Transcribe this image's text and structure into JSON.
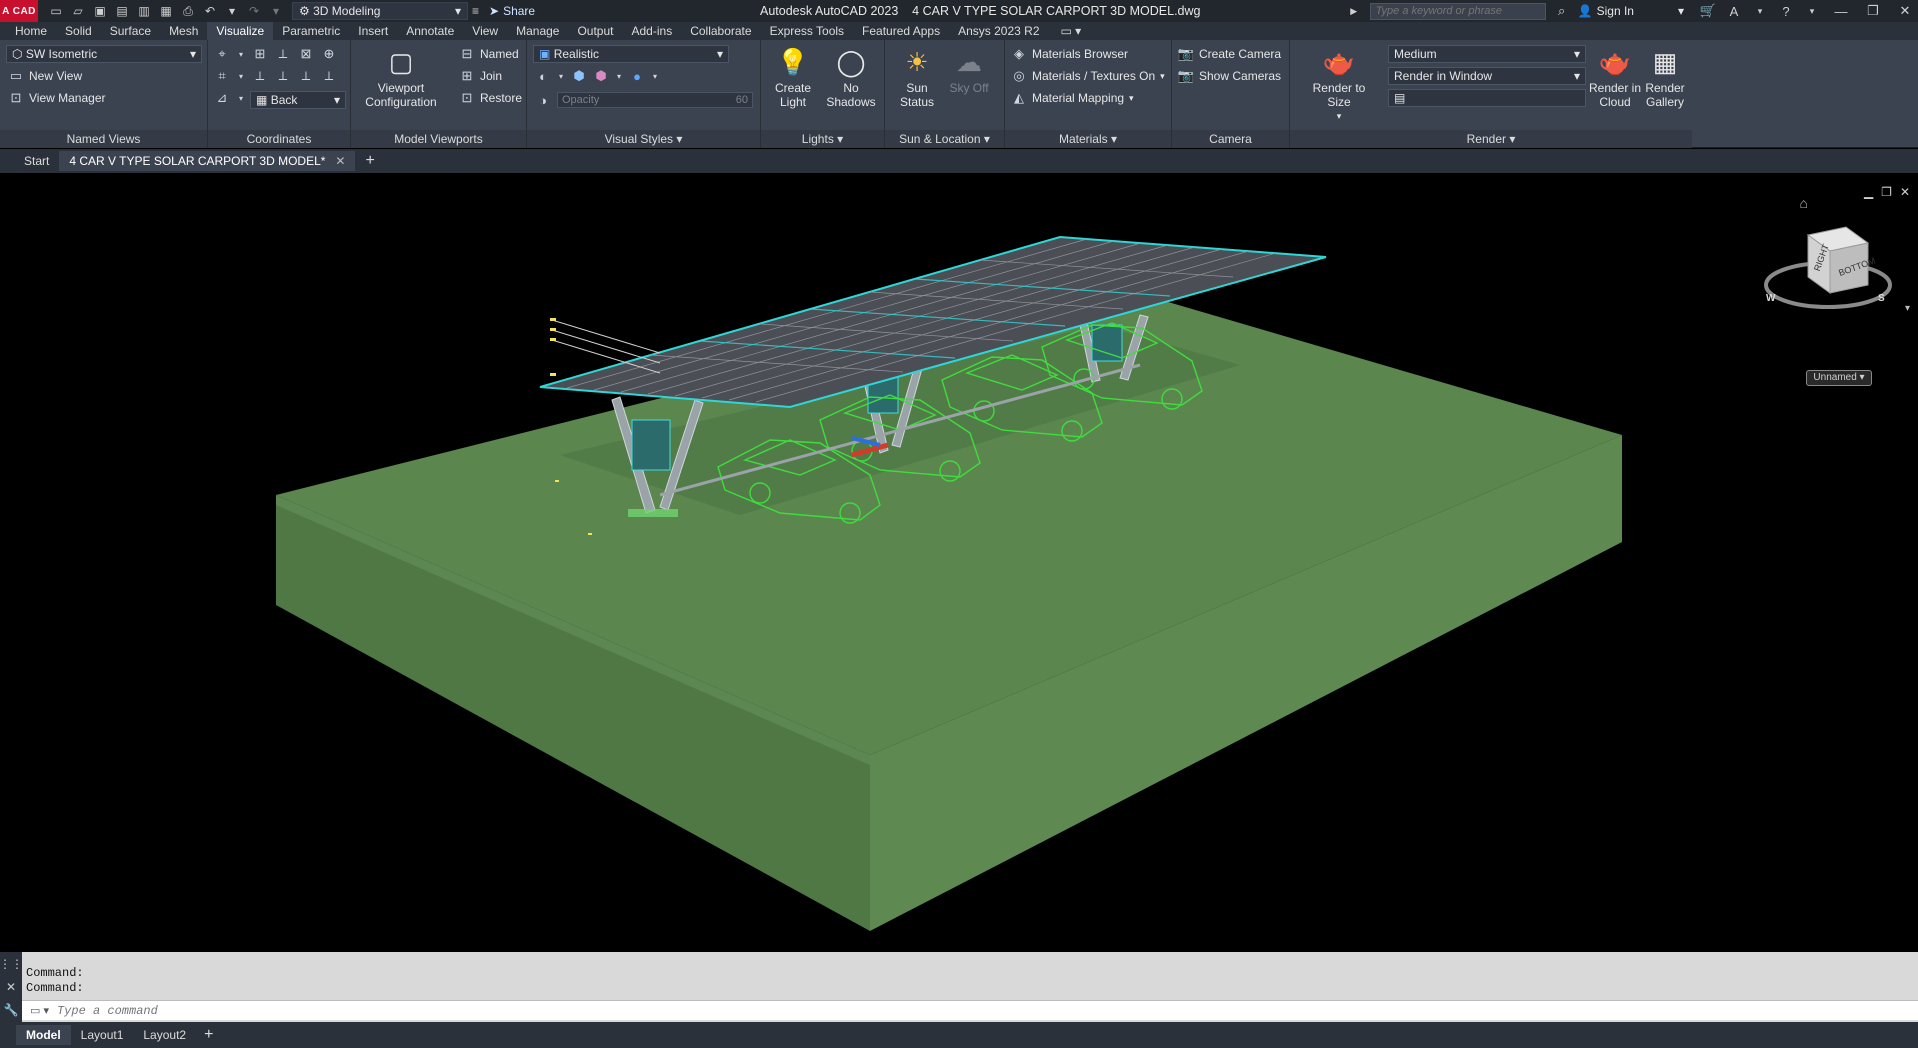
{
  "app": {
    "logo": "A CAD",
    "title": "Autodesk AutoCAD 2023    4 CAR V TYPE SOLAR CARPORT 3D MODEL.dwg",
    "workspace": "3D Modeling",
    "share": "Share",
    "search_placeholder": "Type a keyword or phrase",
    "sign_in": "Sign In"
  },
  "ribbon_tabs": [
    "Home",
    "Solid",
    "Surface",
    "Mesh",
    "Visualize",
    "Parametric",
    "Insert",
    "Annotate",
    "View",
    "Manage",
    "Output",
    "Add-ins",
    "Collaborate",
    "Express Tools",
    "Featured Apps",
    "Ansys  2023 R2"
  ],
  "active_tab": "Visualize",
  "panels": {
    "named_views": {
      "title": "Named Views",
      "view_combo": "SW Isometric",
      "new_view": "New View",
      "view_manager": "View Manager"
    },
    "coordinates": {
      "title": "Coordinates",
      "ucs_combo": "Back"
    },
    "model_viewports": {
      "title": "Model Viewports",
      "viewport_config": "Viewport Configuration",
      "named": "Named",
      "join": "Join",
      "restore": "Restore"
    },
    "visual_styles": {
      "title": "Visual Styles",
      "style_combo": "Realistic",
      "opacity_placeholder": "Opacity",
      "opacity_value": "60"
    },
    "lights": {
      "title": "Lights",
      "create_light": "Create Light",
      "no_shadows": "No Shadows"
    },
    "sun_location": {
      "title": "Sun & Location",
      "sun_status": "Sun Status",
      "sky_off": "Sky Off"
    },
    "materials": {
      "title": "Materials",
      "browser": "Materials Browser",
      "textures": "Materials / Textures On",
      "mapping": "Material Mapping"
    },
    "camera": {
      "title": "Camera",
      "create": "Create Camera",
      "show": "Show  Cameras"
    },
    "render": {
      "title": "Render",
      "render_to_size": "Render to Size",
      "quality_combo": "Medium",
      "output_combo": "Render in Window",
      "cloud": "Render in Cloud",
      "gallery": "Render Gallery"
    }
  },
  "file_tabs": {
    "start": "Start",
    "active": "4 CAR V TYPE SOLAR CARPORT 3D MODEL*"
  },
  "viewcube": {
    "face_right": "RIGHT",
    "face_bottom": "BOTTOM",
    "compass_w": "W",
    "compass_s": "S",
    "ucs_name": "Unnamed"
  },
  "command": {
    "history": [
      "Command:",
      "Command:"
    ],
    "placeholder": "Type a command"
  },
  "layout_tabs": [
    "Model",
    "Layout1",
    "Layout2"
  ],
  "colors": {
    "ground": "#5f8a52",
    "wireframe_green": "#3fdc3f",
    "panel_cyan": "#2fd6d6",
    "accent_red": "#c8102e"
  }
}
